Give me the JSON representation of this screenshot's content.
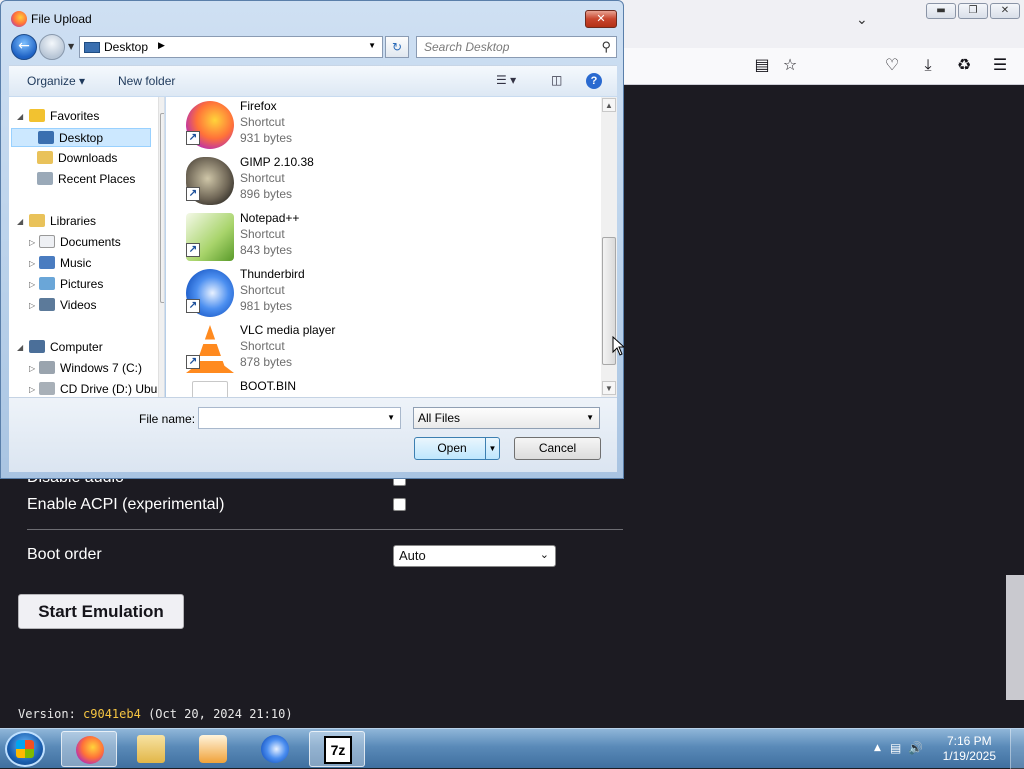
{
  "browser": {
    "bookmark_icon": "reader-icon",
    "controls": [
      "minimize-icon",
      "restore-icon",
      "close-icon"
    ]
  },
  "page": {
    "disable_audio_label": "Disable audio",
    "acpi_label": "Enable ACPI (experimental)",
    "boot_order_label": "Boot order",
    "boot_order_value": "Auto",
    "start_button": "Start Emulation",
    "version_prefix": "Version:",
    "version_hash": "c9041eb4",
    "version_date": "(Oct 20, 2024 21:10)"
  },
  "dialog": {
    "title": "File Upload",
    "address": "Desktop",
    "search_placeholder": "Search Desktop",
    "organize": "Organize",
    "new_folder": "New folder",
    "nav": {
      "favorites": "Favorites",
      "desktop": "Desktop",
      "downloads": "Downloads",
      "recent_places": "Recent Places",
      "libraries": "Libraries",
      "documents": "Documents",
      "music": "Music",
      "pictures": "Pictures",
      "videos": "Videos",
      "computer": "Computer",
      "windows7": "Windows 7 (C:)",
      "cddrive": "CD Drive (D:) Ubu"
    },
    "files": [
      {
        "name": "Firefox",
        "type": "Shortcut",
        "size": "931 bytes"
      },
      {
        "name": "GIMP 2.10.38",
        "type": "Shortcut",
        "size": "896 bytes"
      },
      {
        "name": "Notepad++",
        "type": "Shortcut",
        "size": "843 bytes"
      },
      {
        "name": "Thunderbird",
        "type": "Shortcut",
        "size": "981 bytes"
      },
      {
        "name": "VLC media player",
        "type": "Shortcut",
        "size": "878 bytes"
      },
      {
        "name": "BOOT.BIN",
        "type": "",
        "size": ""
      }
    ],
    "filename_label": "File name:",
    "filename_value": "",
    "filetype": "All Files",
    "open_button": "Open",
    "cancel_button": "Cancel"
  },
  "taskbar": {
    "time": "7:16 PM",
    "date": "1/19/2025",
    "apps": [
      "firefox-icon",
      "explorer-icon",
      "media-player-icon",
      "thunderbird-icon",
      "7zip-icon"
    ]
  }
}
